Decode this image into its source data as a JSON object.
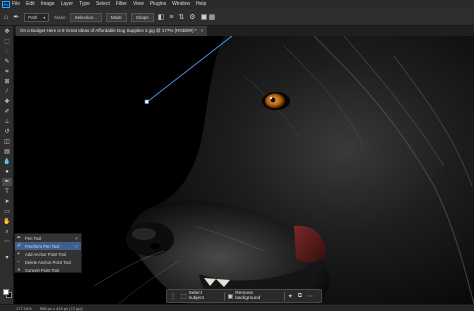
{
  "menubar": {
    "logo": "Ps",
    "items": [
      "File",
      "Edit",
      "Image",
      "Layer",
      "Type",
      "Select",
      "Filter",
      "View",
      "Plugins",
      "Window",
      "Help"
    ]
  },
  "options": {
    "tool_mode": "Path",
    "make_label": "Make:",
    "selection_btn": "Selection...",
    "mask_btn": "Mask",
    "shape_btn": "Shape"
  },
  "document": {
    "tab_title": "On a Budget Here is 8 Great Ideas of Affordable Dog Supplies 3.jpg @ 177% (RGB/8#) *",
    "close": "×"
  },
  "flyout": {
    "items": [
      {
        "label": "Pen Tool",
        "key": "P"
      },
      {
        "label": "Freeform Pen Tool",
        "key": "P"
      },
      {
        "label": "Add Anchor Point Tool",
        "key": ""
      },
      {
        "label": "Delete Anchor Point Tool",
        "key": ""
      },
      {
        "label": "Convert Point Tool",
        "key": ""
      }
    ]
  },
  "taskbar": {
    "select_subject": "Select subject",
    "remove_background": "Remove background"
  },
  "status": {
    "zoom": "177.16%",
    "dimensions": "598 px x 419 px (72 ppi)"
  },
  "colors": {
    "accent": "#31a8ff",
    "eye": "#c8751a",
    "path_stroke": "#4f8fdc"
  }
}
